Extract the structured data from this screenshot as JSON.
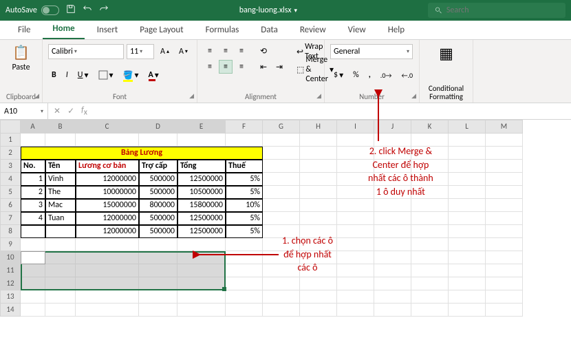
{
  "titlebar": {
    "autosave": "AutoSave",
    "autosave_state": "Off",
    "filename": "bang-luong.xlsx",
    "search_placeholder": "Search"
  },
  "tabs": [
    "File",
    "Home",
    "Insert",
    "Page Layout",
    "Formulas",
    "Data",
    "Review",
    "View",
    "Help"
  ],
  "active_tab": 1,
  "ribbon": {
    "clipboard": {
      "paste": "Paste",
      "label": "Clipboard"
    },
    "font": {
      "name": "Calibri",
      "size": "11",
      "label": "Font"
    },
    "alignment": {
      "wrap": "Wrap Text",
      "merge": "Merge & Center",
      "label": "Alignment"
    },
    "number": {
      "format": "General",
      "label": "Number"
    },
    "cond": {
      "label": "Conditional Formatting"
    }
  },
  "fbar": {
    "ref": "A10"
  },
  "cols": [
    {
      "l": "A",
      "w": 36
    },
    {
      "l": "B",
      "w": 44
    },
    {
      "l": "C",
      "w": 92
    },
    {
      "l": "D",
      "w": 56
    },
    {
      "l": "E",
      "w": 70
    },
    {
      "l": "F",
      "w": 54
    },
    {
      "l": "G",
      "w": 54
    },
    {
      "l": "H",
      "w": 54
    },
    {
      "l": "I",
      "w": 54
    },
    {
      "l": "J",
      "w": 54
    },
    {
      "l": "K",
      "w": 54
    },
    {
      "l": "L",
      "w": 54
    },
    {
      "l": "M",
      "w": 54
    }
  ],
  "rowcount": 14,
  "merged_header": "Bảng Lương",
  "headers": [
    "No.",
    "Tên",
    "Lương cơ bản",
    "Trợ cấp",
    "Tổng",
    "Thuế"
  ],
  "data": [
    {
      "no": "1",
      "ten": "Vinh",
      "luong": "12000000",
      "trocap": "500000",
      "tong": "12500000",
      "thue": "5%"
    },
    {
      "no": "2",
      "ten": "The",
      "luong": "10000000",
      "trocap": "500000",
      "tong": "10500000",
      "thue": "5%"
    },
    {
      "no": "3",
      "ten": "Mac",
      "luong": "15000000",
      "trocap": "800000",
      "tong": "15800000",
      "thue": "10%"
    },
    {
      "no": "4",
      "ten": "Tuan",
      "luong": "12000000",
      "trocap": "500000",
      "tong": "12500000",
      "thue": "5%"
    },
    {
      "no": "",
      "ten": "",
      "luong": "12000000",
      "trocap": "500000",
      "tong": "12500000",
      "thue": "5%"
    }
  ],
  "anno1": "1. chọn các ô\nđể hợp nhất\ncác ô",
  "anno2": "2. click Merge &\nCenter để hợp\nnhất các ô thành\n1 ô duy nhất"
}
